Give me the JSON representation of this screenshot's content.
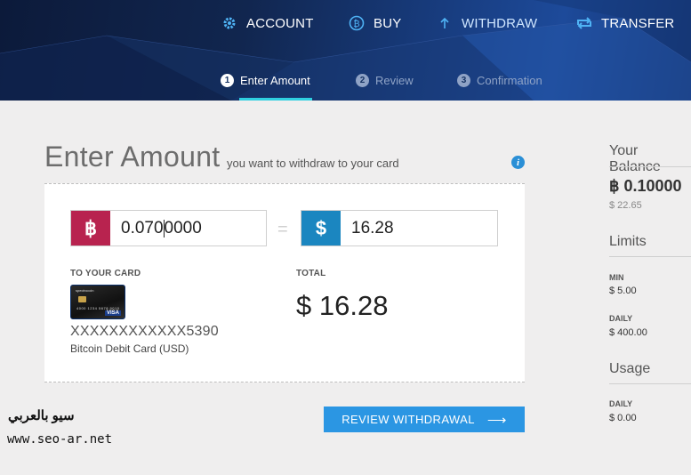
{
  "nav": {
    "items": [
      {
        "label": "ACCOUNT",
        "icon": "gear-icon"
      },
      {
        "label": "BUY",
        "icon": "bitcoin-circle-icon"
      },
      {
        "label": "WITHDRAW",
        "icon": "arrow-up-icon"
      },
      {
        "label": "TRANSFER",
        "icon": "transfer-icon"
      }
    ],
    "active": "WITHDRAW"
  },
  "steps": [
    {
      "num": "1",
      "label": "Enter Amount"
    },
    {
      "num": "2",
      "label": "Review"
    },
    {
      "num": "3",
      "label": "Confirmation"
    }
  ],
  "main": {
    "title": "Enter Amount",
    "subtitle": "you want to withdraw to your card",
    "btc_symbol": "฿",
    "btc_value_before_caret": "0.070",
    "btc_value_after_caret": "0000",
    "equals": "=",
    "usd_symbol": "$",
    "usd_value": "16.28",
    "card_label": "TO YOUR CARD",
    "card_number": "XXXXXXXXXXXX5390",
    "card_name": "Bitcoin Debit Card (USD)",
    "total_label": "TOTAL",
    "total_value": "$ 16.28",
    "review_button": "REVIEW WITHDRAWAL",
    "review_arrow": "⟶"
  },
  "sidebar": {
    "balance_heading": "Your Balance",
    "balance_btc": "฿ 0.10000",
    "balance_usd": "$ 22.65",
    "limits_heading": "Limits",
    "min_label": "MIN",
    "min_value": "$ 5.00",
    "daily_label": "DAILY",
    "daily_limit_value": "$ 400.00",
    "usage_heading": "Usage",
    "usage_daily_label": "DAILY",
    "usage_daily_value": "$ 0.00"
  },
  "watermark": {
    "arabic": "سيو بالعربي",
    "url": "www.seo-ar.net"
  },
  "colors": {
    "btc_accent": "#b8234f",
    "usd_accent": "#1b86c0",
    "button": "#2b96e3",
    "step_underline": "#2fd0e0"
  }
}
